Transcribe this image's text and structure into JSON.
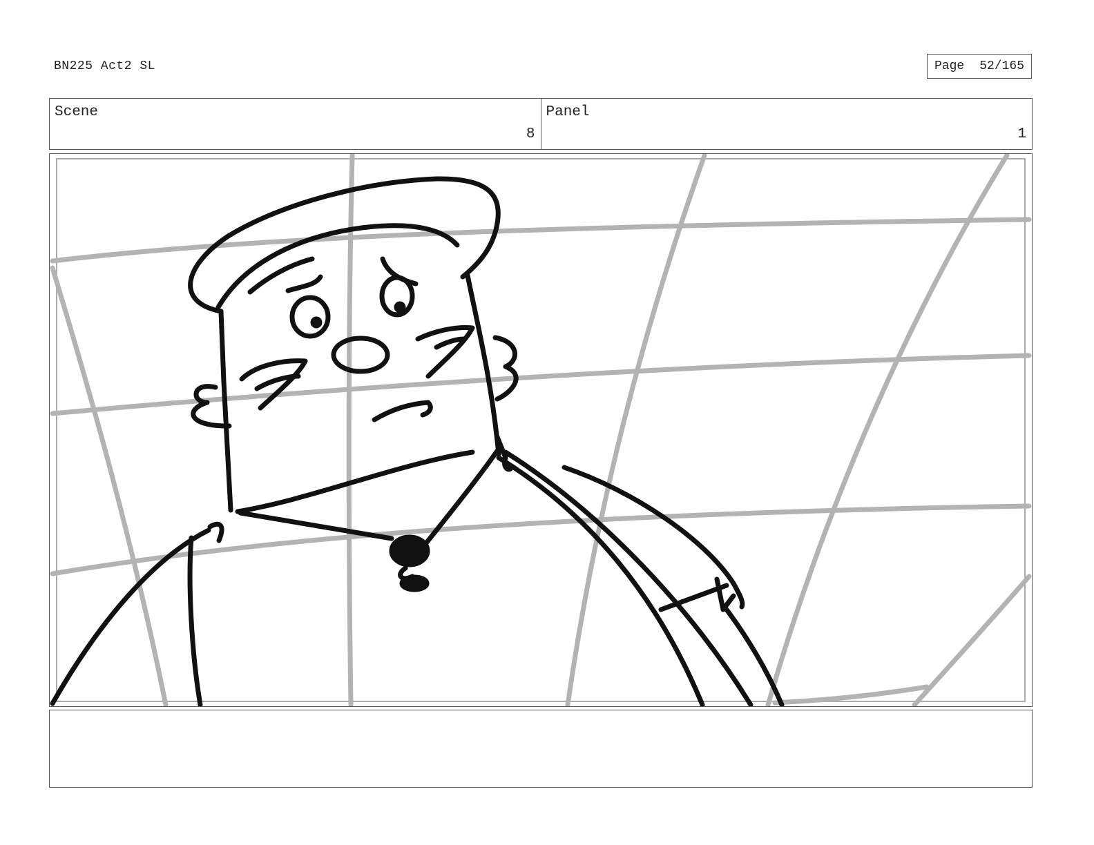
{
  "header": {
    "title": "BN225 Act2 SL",
    "page_label": "Page",
    "page_number": "52/165"
  },
  "info": {
    "scene_label": "Scene",
    "scene_value": "8",
    "panel_label": "Panel",
    "panel_value": "1"
  },
  "notes": {
    "text": ""
  },
  "colors": {
    "grid": "#b3b3b3",
    "ink": "#111111",
    "border": "#555555"
  }
}
